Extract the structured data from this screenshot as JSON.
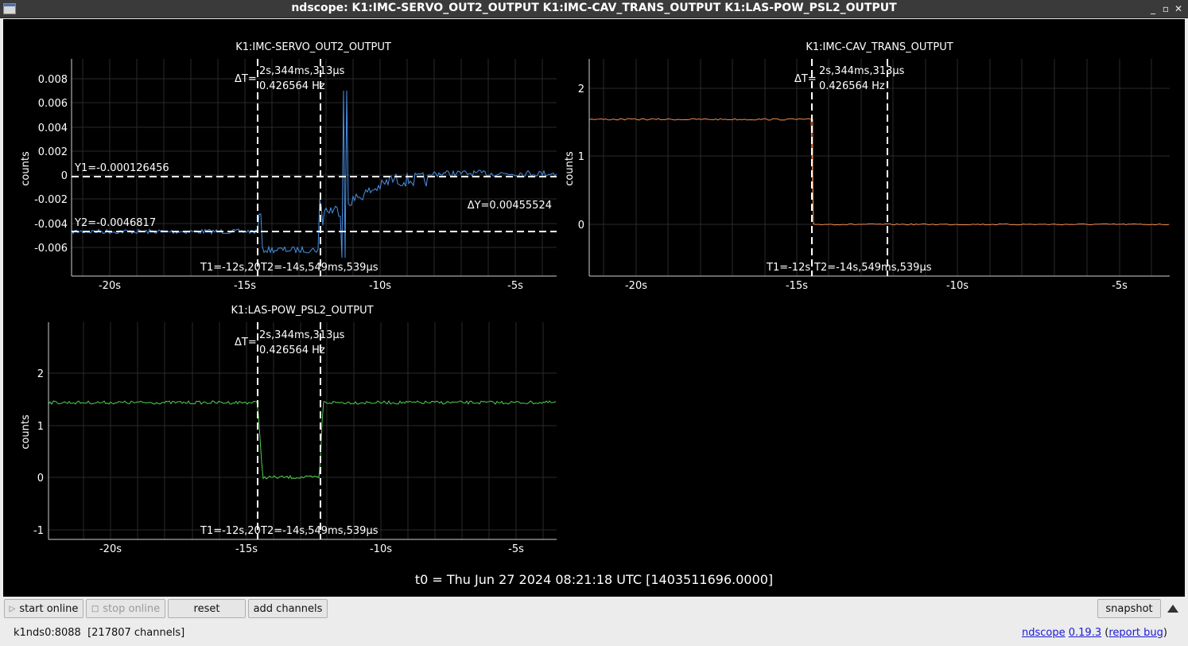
{
  "window": {
    "title": "ndscope: K1:IMC-SERVO_OUT2_OUTPUT K1:IMC-CAV_TRANS_OUTPUT K1:LAS-POW_PSL2_OUTPUT",
    "min_label": "_",
    "max_label": "▫",
    "close_label": "✕"
  },
  "plots": {
    "p1": {
      "title": "K1:IMC-SERVO_OUT2_OUTPUT",
      "ylabel": "counts",
      "yticks": [
        "0.008",
        "0.006",
        "0.004",
        "0.002",
        "0",
        "-0.002",
        "-0.004",
        "-0.006"
      ],
      "xticks": [
        "-20s",
        "-15s",
        "-10s",
        "-5s"
      ],
      "dt_label": "ΔT=",
      "dt_value": "2s,344ms,313µs",
      "freq": "0.426564 Hz",
      "y1_label": "Y1=-0.000126456",
      "y2_label": "Y2=-0.0046817",
      "dy_label": "ΔY=0.00455524",
      "t1_label": "T1=-12s,20",
      "t2_label": "T2=-14s,549ms,539µs",
      "color": "#4a90e2"
    },
    "p2": {
      "title": "K1:IMC-CAV_TRANS_OUTPUT",
      "ylabel": "counts",
      "yticks": [
        "2",
        "1",
        "0"
      ],
      "xticks": [
        "-20s",
        "-15s",
        "-10s",
        "-5s"
      ],
      "dt_label": "ΔT=",
      "dt_value": "2s,344ms,313µs",
      "freq": "0.426564 Hz",
      "t1_label": "T1=-12s",
      "t2_label": "T2=-14s,549ms,539µs",
      "color": "#f08a4b"
    },
    "p3": {
      "title": "K1:LAS-POW_PSL2_OUTPUT",
      "ylabel": "counts",
      "yticks": [
        "2",
        "1",
        "0",
        "-1"
      ],
      "xticks": [
        "-20s",
        "-15s",
        "-10s",
        "-5s"
      ],
      "dt_label": "ΔT=",
      "dt_value": "2s,344ms,313µs",
      "freq": "0.426564 Hz",
      "t1_label": "T1=-12s,20",
      "t2_label": "T2=-14s,549ms,539µs",
      "color": "#4fd04f"
    }
  },
  "t0_label": "t0 = Thu Jun 27 2024 08:21:18 UTC [1403511696.0000]",
  "toolbar": {
    "start_online": "start online",
    "stop_online": "stop online",
    "reset": "reset",
    "add_channels": "add channels",
    "snapshot": "snapshot"
  },
  "status": {
    "server": "k1nds0:8088",
    "channels": "[217807 channels]",
    "app": "ndscope",
    "version": "0.19.3",
    "report": "report bug"
  }
}
